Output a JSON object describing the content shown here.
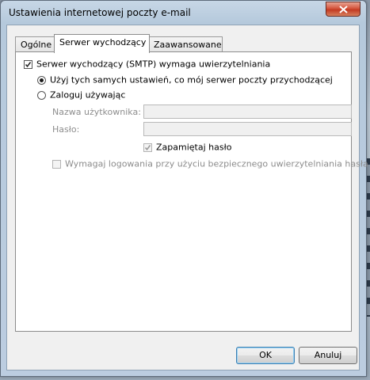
{
  "window": {
    "title": "Ustawienia internetowej poczty e-mail"
  },
  "tabs": [
    {
      "label": "Ogólne",
      "active": false
    },
    {
      "label": "Serwer wychodzący",
      "active": true
    },
    {
      "label": "Zaawansowane",
      "active": false
    }
  ],
  "outgoing": {
    "smtp_auth_label": "Serwer wychodzący (SMTP) wymaga uwierzytelniania",
    "smtp_auth_checked": true,
    "use_same_settings_label": "Użyj tych samych ustawień, co mój serwer poczty przychodzącej",
    "use_same_settings_selected": true,
    "log_on_using_label": "Zaloguj używając",
    "log_on_using_selected": false,
    "username_label": "Nazwa użytkownika:",
    "username_value": "",
    "password_label": "Hasło:",
    "password_value": "",
    "remember_password_label": "Zapamiętaj hasło",
    "remember_password_checked": true,
    "spa_label": "Wymagaj logowania przy użyciu bezpiecznego uwierzytelniania hasła",
    "spa_checked": false
  },
  "buttons": {
    "ok": "OK",
    "cancel": "Anuluj"
  },
  "colors": {
    "close_button": "#c33a22",
    "panel_background": "#ffffff",
    "dialog_background": "#f0f0f0",
    "default_button_border": "#3c7fb1"
  },
  "icons": {
    "close": "close-icon",
    "check": "checkmark-icon"
  }
}
